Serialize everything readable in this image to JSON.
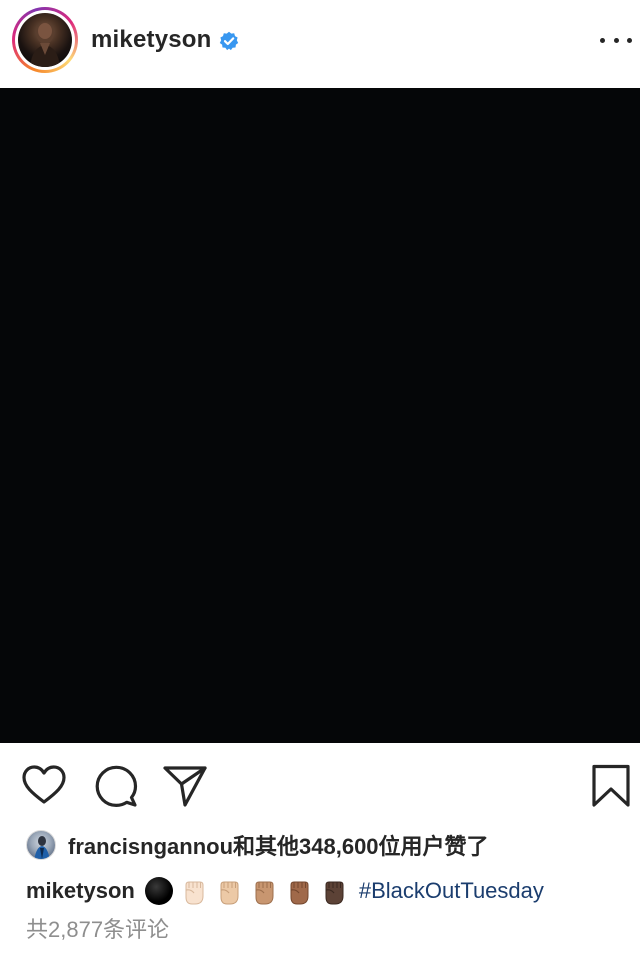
{
  "header": {
    "username": "miketyson",
    "verified": true,
    "avatar_icon": "profile-avatar",
    "more_icon": "more-options-icon"
  },
  "post": {
    "image_color": "#050608"
  },
  "actions": {
    "like_icon": "heart-icon",
    "comment_icon": "comment-icon",
    "share_icon": "paper-plane-icon",
    "save_icon": "bookmark-icon"
  },
  "likes": {
    "text": "francisngannou和其他348,600位用户赞了"
  },
  "caption": {
    "username": "miketyson",
    "emojis": [
      "black-circle",
      "raised-fist-light",
      "raised-fist-medium-light",
      "raised-fist-medium",
      "raised-fist-medium-dark",
      "raised-fist-dark"
    ],
    "hashtag": "#BlackOutTuesday"
  },
  "comments": {
    "text": "共2,877条评论"
  },
  "colors": {
    "hashtag": "#1b3d6e",
    "verified": "#3897f0",
    "muted": "#8e8e8e",
    "text": "#262626"
  }
}
